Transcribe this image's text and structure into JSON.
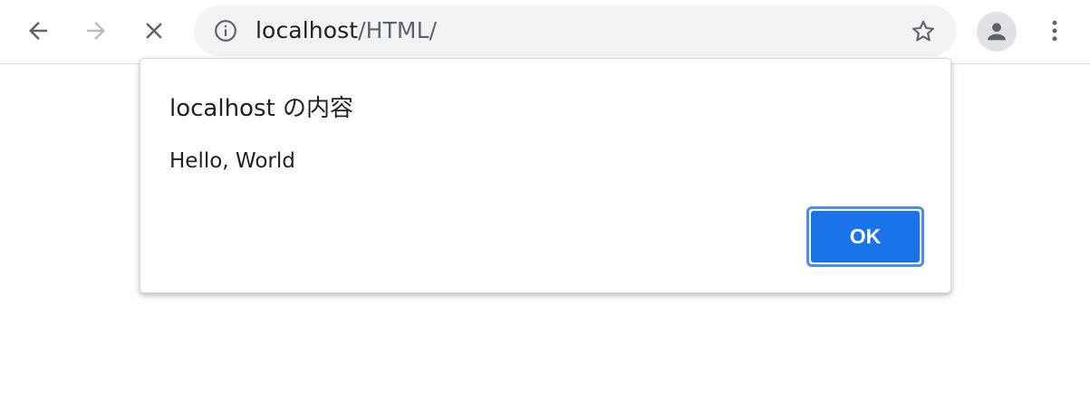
{
  "browser": {
    "url": {
      "host": "localhost",
      "path": "/HTML/"
    },
    "icons": {
      "back": "back-arrow-icon",
      "forward": "forward-arrow-icon",
      "stop": "close-icon",
      "info": "info-icon",
      "bookmark": "star-icon",
      "profile": "person-icon",
      "menu": "more-vertical-icon"
    }
  },
  "dialog": {
    "title": "localhost の内容",
    "message": "Hello, World",
    "ok_label": "OK"
  },
  "colors": {
    "accent": "#1a73e8",
    "omnibox_bg": "#f1f3f4",
    "text": "#202124",
    "muted": "#5f6368"
  }
}
